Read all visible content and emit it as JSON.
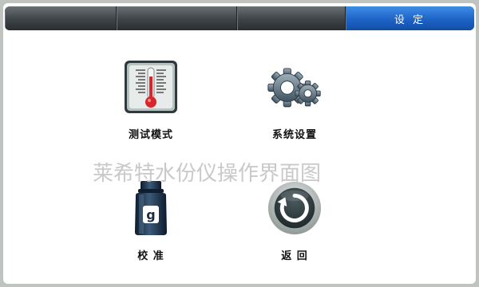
{
  "tabs": [
    {
      "label": ""
    },
    {
      "label": ""
    },
    {
      "label": ""
    },
    {
      "label": "设 定"
    }
  ],
  "menu": {
    "test_mode": {
      "label": "测试模式",
      "icon": "thermometer-icon"
    },
    "system_settings": {
      "label": "系统设置",
      "icon": "gears-icon"
    },
    "calibrate": {
      "label": "校 准",
      "icon": "weight-icon"
    },
    "back": {
      "label": "返 回",
      "icon": "return-icon"
    }
  },
  "watermark": "莱希特水份仪操作界面图",
  "colors": {
    "active_tab": "#1e63c6",
    "tabbar": "#3e4347",
    "thermometer_red": "#d8262c",
    "icon_dark": "#2f3a3e"
  }
}
